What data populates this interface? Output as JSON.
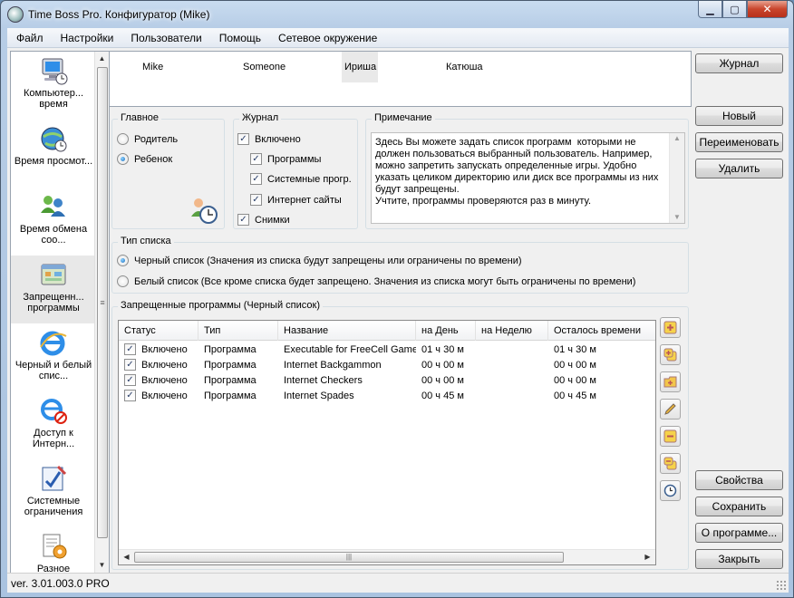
{
  "window": {
    "title": "Time Boss Pro. Конфигуратор (Mike)"
  },
  "menu": [
    "Файл",
    "Настройки",
    "Пользователи",
    "Помощь",
    "Сетевое окружение"
  ],
  "sidebar": {
    "items": [
      {
        "label": "Компьютер... время",
        "icon": "computer-icon"
      },
      {
        "label": "Время просмот...",
        "icon": "internet-globe-icon"
      },
      {
        "label": "Время обмена соо...",
        "icon": "messenger-users-icon"
      },
      {
        "label": "Запрещенн... программы",
        "icon": "forbidden-programs-icon",
        "selected": true
      },
      {
        "label": "Черный и белый спис...",
        "icon": "ie-list-icon"
      },
      {
        "label": "Доступ к Интерн...",
        "icon": "ie-blocked-icon"
      },
      {
        "label": "Системные ограничения",
        "icon": "system-restrictions-icon"
      },
      {
        "label": "Разное",
        "icon": "misc-icon"
      }
    ]
  },
  "users": [
    "Mike",
    "Someone",
    "Ириша",
    "Катюша"
  ],
  "active_user": "Ириша",
  "main_group": {
    "title": "Главное",
    "parent": "Родитель",
    "child": "Ребенок",
    "selected": "Ребенок"
  },
  "log_group": {
    "title": "Журнал",
    "enabled": "Включено",
    "programs": "Программы",
    "system": "Системные прогр.",
    "websites": "Интернет сайты",
    "screenshots": "Снимки"
  },
  "note": {
    "title": "Примечание",
    "text": "Здесь Вы можете задать список программ  которыми не должен пользоваться выбранный пользователь. Например, можно запретить запускать определенные игры. Удобно указать целиком директорию или диск все программы из них будут запрещены.\nУчтите, программы проверяются раз в минуту."
  },
  "list_type": {
    "title": "Тип списка",
    "black": "Черный список (Значения из списка будут запрещены или ограничены по времени)",
    "white": "Белый список (Все кроме списка будет запрещено. Значения из списка могут быть ограничены по времени)",
    "selected": "black"
  },
  "programs": {
    "title": "Запрещенные программы (Черный список)",
    "columns": [
      "Статус",
      "Тип",
      "Название",
      "на День",
      "на Неделю",
      "Осталось времени"
    ],
    "rows": [
      {
        "status": "Включено",
        "type": "Программа",
        "name": "Executable for FreeCell Game",
        "day": "01 ч 30 м",
        "week": "",
        "left": "01 ч 30 м"
      },
      {
        "status": "Включено",
        "type": "Программа",
        "name": "Internet Backgammon",
        "day": "00 ч 00 м",
        "week": "",
        "left": "00 ч 00 м"
      },
      {
        "status": "Включено",
        "type": "Программа",
        "name": "Internet Checkers",
        "day": "00 ч 00 м",
        "week": "",
        "left": "00 ч 00 м"
      },
      {
        "status": "Включено",
        "type": "Программа",
        "name": "Internet Spades",
        "day": "00 ч 45 м",
        "week": "",
        "left": "00 ч 45 м"
      }
    ]
  },
  "buttons": {
    "journal": "Журнал",
    "new": "Новый",
    "rename": "Переименовать",
    "delete": "Удалить",
    "properties": "Свойства",
    "save": "Сохранить",
    "about": "О программе...",
    "close": "Закрыть"
  },
  "status": {
    "version": "ver. 3.01.003.0 PRO"
  }
}
